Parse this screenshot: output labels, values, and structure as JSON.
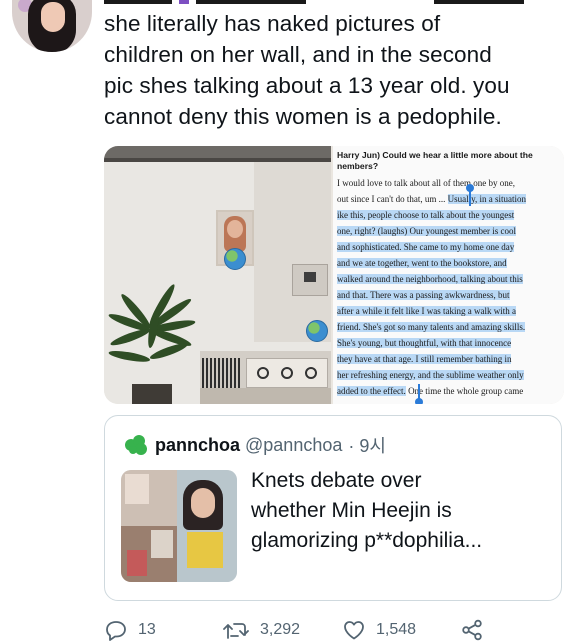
{
  "tweet": {
    "text_lines": [
      "she literally has naked pictures of",
      "children on her wall, and in the second",
      "pic shes talking about a 13 year old. you",
      "cannot deny this women is a pedophile."
    ]
  },
  "document": {
    "heading_lines": [
      "Harry Jun) Could we hear a little more about the",
      "nembers?"
    ],
    "lines": [
      {
        "plain": "I would love to talk about all of them one by one,",
        "highlight": ""
      },
      {
        "plain": "out since I can't do that, um ... ",
        "highlight": "Usually, in a situation"
      },
      {
        "plain": "",
        "highlight": "ike this, people choose to talk about the youngest"
      },
      {
        "plain": "",
        "highlight": "one, right? (laughs) Our youngest member is cool"
      },
      {
        "plain": "",
        "highlight": "and sophisticated. She came to my home one day"
      },
      {
        "plain": "",
        "highlight": "and we ate together, went to the bookstore, and"
      },
      {
        "plain": "",
        "highlight": "walked around the neighborhood, talking about this"
      },
      {
        "plain": "",
        "highlight": "and that. There was a passing awkwardness, but"
      },
      {
        "plain": "",
        "highlight": "after a while it felt like I was taking a walk with a"
      },
      {
        "plain": "",
        "highlight": "friend. She's got so many talents and amazing skills."
      },
      {
        "plain": "",
        "highlight": "She's young, but thoughtful, with that innocence"
      },
      {
        "plain": "",
        "highlight": "they have at that age. I still remember bathing in"
      },
      {
        "plain": "",
        "highlight": "her refreshing energy, and the sublime weather only"
      },
      {
        "plain": "",
        "highlight": "added to the effect.",
        "tail": " One time the whole group came"
      }
    ]
  },
  "quote": {
    "name": "pannchoa",
    "handle": "@pannchoa",
    "time": "· 9시",
    "text_lines": [
      "Knets debate over",
      "whether Min Heejin is",
      "glamorizing p**dophilia..."
    ]
  },
  "actions": {
    "replies": "13",
    "retweets": "3,292",
    "likes": "1,548"
  },
  "colors": {
    "text": "#0f1419",
    "secondary": "#536471",
    "border": "#cfd9de",
    "highlight": "#b9d8f5",
    "handle_blue": "#2b7bd8",
    "pannchoa_green": "#37b24d"
  }
}
